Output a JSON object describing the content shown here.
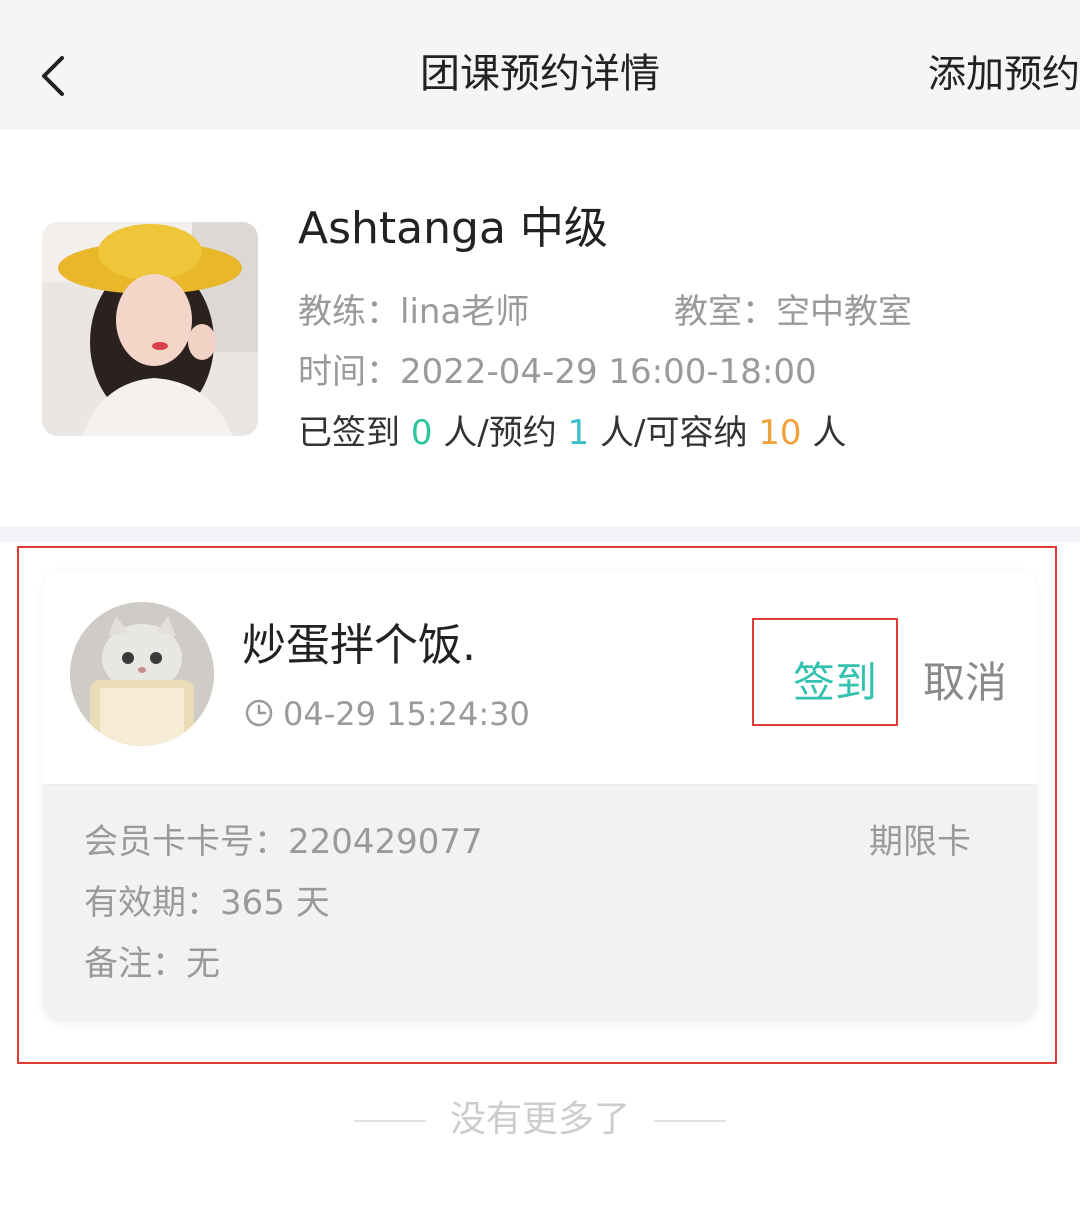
{
  "header": {
    "title": "团课预约详情",
    "action_label": "添加预约"
  },
  "course": {
    "name": "Ashtanga 中级",
    "coach_label": "教练：",
    "coach_value": "lina老师",
    "room_label": "教室：",
    "room_value": "空中教室",
    "time_label": "时间：",
    "time_value": "2022-04-29 16:00-18:00",
    "stats": {
      "checked_in_prefix": "已签到",
      "checked_in": "0",
      "booked_prefix": "人/预约",
      "booked": "1",
      "capacity_prefix": "人/可容纳",
      "capacity": "10",
      "suffix": "人"
    }
  },
  "booking": {
    "member_name": "炒蛋拌个饭.",
    "book_time": "04-29 15:24:30",
    "checkin_label": "签到",
    "cancel_label": "取消",
    "card_no_label": "会员卡卡号：",
    "card_no": "220429077",
    "validity_label": "有效期：",
    "validity": "365 天",
    "remark_label": "备注：",
    "remark": "无",
    "card_type": "期限卡"
  },
  "footer": {
    "no_more": "没有更多了"
  },
  "colors": {
    "accent_teal": "#34c2b0",
    "stat_green": "#2fc4a0",
    "stat_teal": "#3cbfc7",
    "stat_orange": "#f0a23a",
    "highlight_red": "#e53935"
  }
}
